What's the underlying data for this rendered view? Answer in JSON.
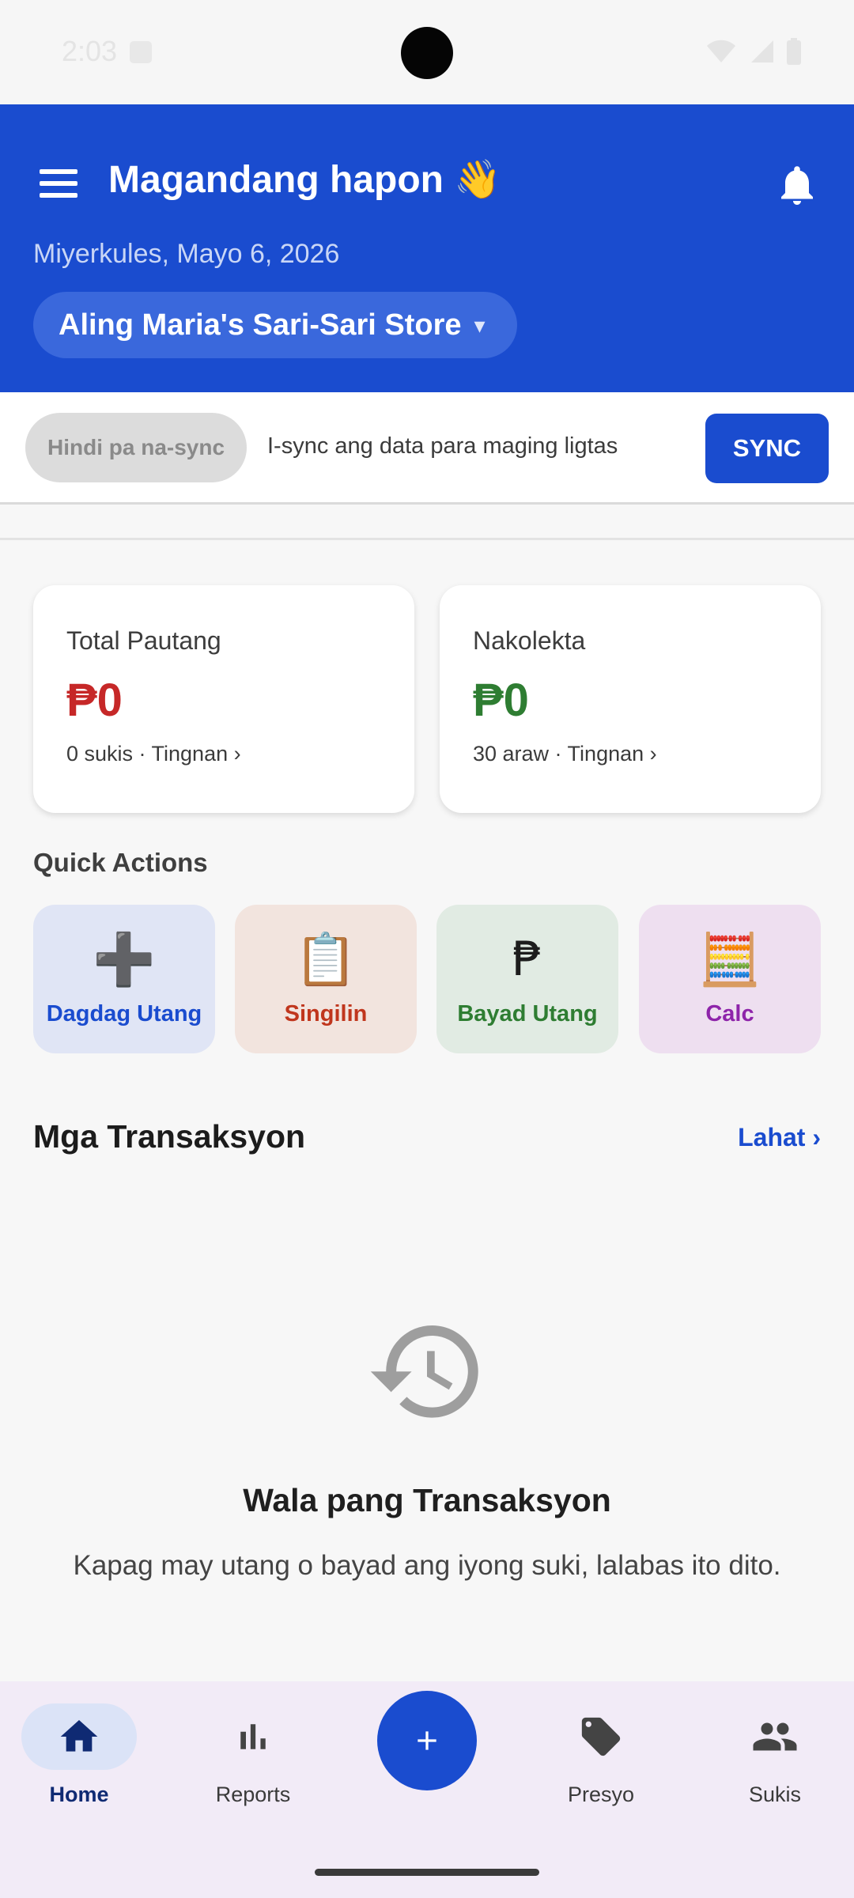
{
  "status_bar": {
    "time": "2:03"
  },
  "header": {
    "greeting": "Magandang hapon 👋",
    "date": "Miyerkules, Mayo 6, 2026",
    "store_name": "Aling Maria's Sari-Sari Store",
    "store_caret": "▾",
    "bg_color": "#1a4ccf"
  },
  "sync": {
    "status": "Hindi pa na-sync",
    "message": "I-sync ang data para maging ligtas",
    "button": "SYNC"
  },
  "cards": [
    {
      "title": "Total Pautang",
      "amount": "₱0",
      "subtitle": "0 sukis · Tingnan ›",
      "color": "#c62828"
    },
    {
      "title": "Nakolekta",
      "amount": "₱0",
      "subtitle": "30 araw · Tingnan ›",
      "color": "#2e7d32"
    }
  ],
  "quick_actions": {
    "title": "Quick Actions",
    "items": [
      {
        "label": "Dagdag Utang",
        "icon": "➕",
        "icon_name": "plus-icon"
      },
      {
        "label": "Singilin",
        "icon": "📋",
        "icon_name": "clipboard-icon"
      },
      {
        "label": "Bayad Utang",
        "icon": "₱",
        "icon_name": "peso-icon"
      },
      {
        "label": "Calc",
        "icon": "🧮",
        "icon_name": "abacus-icon"
      }
    ]
  },
  "transactions": {
    "title": "Mga Transaksyon",
    "see_all": "Lahat ›",
    "empty_title": "Wala pang Transaksyon",
    "empty_body": "Kapag may utang o bayad ang iyong suki, lalabas ito dito."
  },
  "bottom_nav": {
    "items": [
      {
        "label": "Home",
        "icon": "home-icon",
        "active": true
      },
      {
        "label": "Reports",
        "icon": "bar-chart-icon",
        "active": false
      },
      {
        "label": "Presyo",
        "icon": "tag-icon",
        "active": false
      },
      {
        "label": "Sukis",
        "icon": "people-icon",
        "active": false
      }
    ],
    "fab_icon": "add-icon"
  }
}
